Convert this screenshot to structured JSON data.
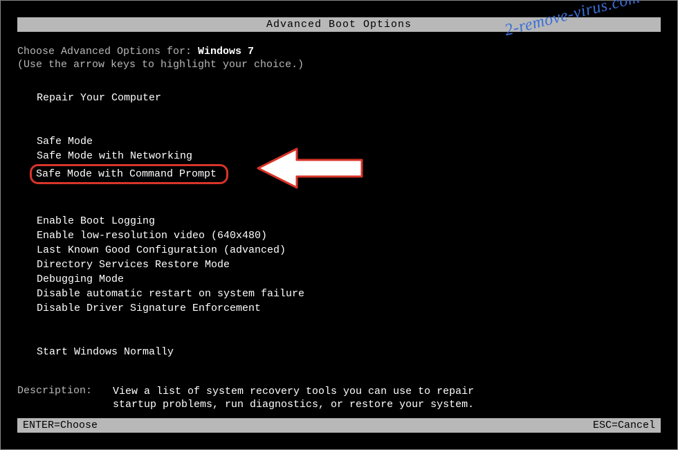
{
  "watermark": "2-remove-virus.com",
  "title": "Advanced Boot Options",
  "header": {
    "prefix": "Choose Advanced Options for: ",
    "os_name": "Windows 7",
    "subheader": "(Use the arrow keys to highlight your choice.)"
  },
  "menu": {
    "group0": [
      "Repair Your Computer"
    ],
    "group1": [
      "Safe Mode",
      "Safe Mode with Networking",
      "Safe Mode with Command Prompt"
    ],
    "group2": [
      "Enable Boot Logging",
      "Enable low-resolution video (640x480)",
      "Last Known Good Configuration (advanced)",
      "Directory Services Restore Mode",
      "Debugging Mode",
      "Disable automatic restart on system failure",
      "Disable Driver Signature Enforcement"
    ],
    "group3": [
      "Start Windows Normally"
    ]
  },
  "highlighted_item": "Safe Mode with Command Prompt",
  "description": {
    "label": "Description:",
    "text": "View a list of system recovery tools you can use to repair startup problems, run diagnostics, or restore your system."
  },
  "footer": {
    "enter": "ENTER=Choose",
    "esc": "ESC=Cancel"
  },
  "annotation": {
    "arrow_color": "#ffffff",
    "arrow_stroke": "#d8342a",
    "highlight_stroke": "#d8342a"
  }
}
